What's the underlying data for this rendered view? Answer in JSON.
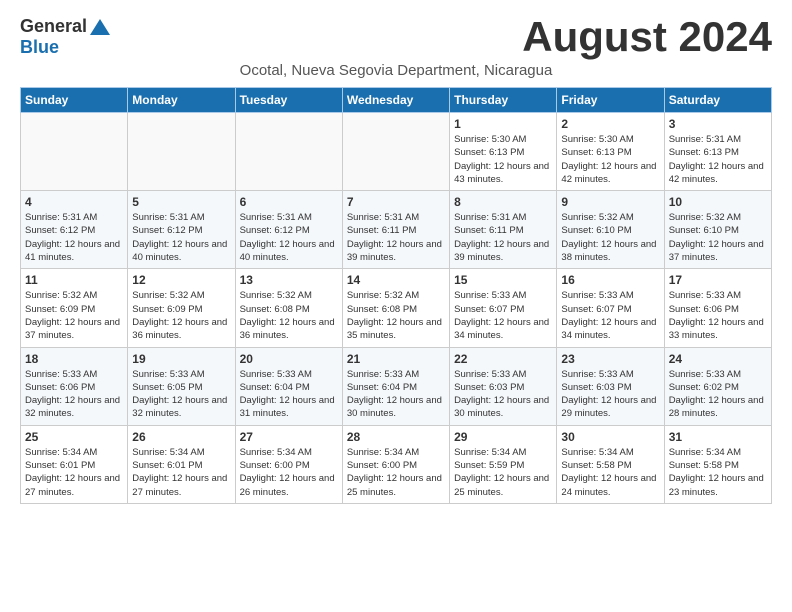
{
  "logo": {
    "general": "General",
    "blue": "Blue"
  },
  "title": "August 2024",
  "subtitle": "Ocotal, Nueva Segovia Department, Nicaragua",
  "days_of_week": [
    "Sunday",
    "Monday",
    "Tuesday",
    "Wednesday",
    "Thursday",
    "Friday",
    "Saturday"
  ],
  "weeks": [
    [
      {
        "day": "",
        "info": ""
      },
      {
        "day": "",
        "info": ""
      },
      {
        "day": "",
        "info": ""
      },
      {
        "day": "",
        "info": ""
      },
      {
        "day": "1",
        "info": "Sunrise: 5:30 AM\nSunset: 6:13 PM\nDaylight: 12 hours\nand 43 minutes."
      },
      {
        "day": "2",
        "info": "Sunrise: 5:30 AM\nSunset: 6:13 PM\nDaylight: 12 hours\nand 42 minutes."
      },
      {
        "day": "3",
        "info": "Sunrise: 5:31 AM\nSunset: 6:13 PM\nDaylight: 12 hours\nand 42 minutes."
      }
    ],
    [
      {
        "day": "4",
        "info": "Sunrise: 5:31 AM\nSunset: 6:12 PM\nDaylight: 12 hours\nand 41 minutes."
      },
      {
        "day": "5",
        "info": "Sunrise: 5:31 AM\nSunset: 6:12 PM\nDaylight: 12 hours\nand 40 minutes."
      },
      {
        "day": "6",
        "info": "Sunrise: 5:31 AM\nSunset: 6:12 PM\nDaylight: 12 hours\nand 40 minutes."
      },
      {
        "day": "7",
        "info": "Sunrise: 5:31 AM\nSunset: 6:11 PM\nDaylight: 12 hours\nand 39 minutes."
      },
      {
        "day": "8",
        "info": "Sunrise: 5:31 AM\nSunset: 6:11 PM\nDaylight: 12 hours\nand 39 minutes."
      },
      {
        "day": "9",
        "info": "Sunrise: 5:32 AM\nSunset: 6:10 PM\nDaylight: 12 hours\nand 38 minutes."
      },
      {
        "day": "10",
        "info": "Sunrise: 5:32 AM\nSunset: 6:10 PM\nDaylight: 12 hours\nand 37 minutes."
      }
    ],
    [
      {
        "day": "11",
        "info": "Sunrise: 5:32 AM\nSunset: 6:09 PM\nDaylight: 12 hours\nand 37 minutes."
      },
      {
        "day": "12",
        "info": "Sunrise: 5:32 AM\nSunset: 6:09 PM\nDaylight: 12 hours\nand 36 minutes."
      },
      {
        "day": "13",
        "info": "Sunrise: 5:32 AM\nSunset: 6:08 PM\nDaylight: 12 hours\nand 36 minutes."
      },
      {
        "day": "14",
        "info": "Sunrise: 5:32 AM\nSunset: 6:08 PM\nDaylight: 12 hours\nand 35 minutes."
      },
      {
        "day": "15",
        "info": "Sunrise: 5:33 AM\nSunset: 6:07 PM\nDaylight: 12 hours\nand 34 minutes."
      },
      {
        "day": "16",
        "info": "Sunrise: 5:33 AM\nSunset: 6:07 PM\nDaylight: 12 hours\nand 34 minutes."
      },
      {
        "day": "17",
        "info": "Sunrise: 5:33 AM\nSunset: 6:06 PM\nDaylight: 12 hours\nand 33 minutes."
      }
    ],
    [
      {
        "day": "18",
        "info": "Sunrise: 5:33 AM\nSunset: 6:06 PM\nDaylight: 12 hours\nand 32 minutes."
      },
      {
        "day": "19",
        "info": "Sunrise: 5:33 AM\nSunset: 6:05 PM\nDaylight: 12 hours\nand 32 minutes."
      },
      {
        "day": "20",
        "info": "Sunrise: 5:33 AM\nSunset: 6:04 PM\nDaylight: 12 hours\nand 31 minutes."
      },
      {
        "day": "21",
        "info": "Sunrise: 5:33 AM\nSunset: 6:04 PM\nDaylight: 12 hours\nand 30 minutes."
      },
      {
        "day": "22",
        "info": "Sunrise: 5:33 AM\nSunset: 6:03 PM\nDaylight: 12 hours\nand 30 minutes."
      },
      {
        "day": "23",
        "info": "Sunrise: 5:33 AM\nSunset: 6:03 PM\nDaylight: 12 hours\nand 29 minutes."
      },
      {
        "day": "24",
        "info": "Sunrise: 5:33 AM\nSunset: 6:02 PM\nDaylight: 12 hours\nand 28 minutes."
      }
    ],
    [
      {
        "day": "25",
        "info": "Sunrise: 5:34 AM\nSunset: 6:01 PM\nDaylight: 12 hours\nand 27 minutes."
      },
      {
        "day": "26",
        "info": "Sunrise: 5:34 AM\nSunset: 6:01 PM\nDaylight: 12 hours\nand 27 minutes."
      },
      {
        "day": "27",
        "info": "Sunrise: 5:34 AM\nSunset: 6:00 PM\nDaylight: 12 hours\nand 26 minutes."
      },
      {
        "day": "28",
        "info": "Sunrise: 5:34 AM\nSunset: 6:00 PM\nDaylight: 12 hours\nand 25 minutes."
      },
      {
        "day": "29",
        "info": "Sunrise: 5:34 AM\nSunset: 5:59 PM\nDaylight: 12 hours\nand 25 minutes."
      },
      {
        "day": "30",
        "info": "Sunrise: 5:34 AM\nSunset: 5:58 PM\nDaylight: 12 hours\nand 24 minutes."
      },
      {
        "day": "31",
        "info": "Sunrise: 5:34 AM\nSunset: 5:58 PM\nDaylight: 12 hours\nand 23 minutes."
      }
    ]
  ]
}
